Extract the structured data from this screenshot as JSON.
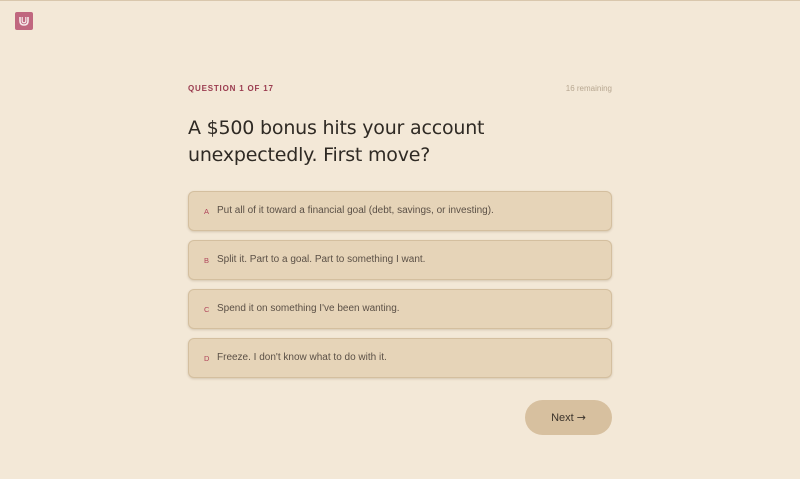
{
  "brand": {
    "logo_icon": "u-shaped-logo-icon",
    "logo_color": "#c0677f"
  },
  "question": {
    "counter": "QUESTION 1 OF 17",
    "remaining": "16 remaining",
    "title": "A $500 bonus hits your account unexpectedly. First move?"
  },
  "options": [
    {
      "letter": "A",
      "text": "Put all of it toward a financial goal (debt, savings, or investing)."
    },
    {
      "letter": "B",
      "text": "Split it. Part to a goal. Part to something I want."
    },
    {
      "letter": "C",
      "text": "Spend it on something I've been wanting."
    },
    {
      "letter": "D",
      "text": "Freeze. I don't know what to do with it."
    }
  ],
  "next_button": {
    "label": "Next",
    "arrow": "→",
    "arrow_icon": "arrow-right-icon"
  },
  "colors": {
    "background": "#f3e8d7",
    "option_background": "#e6d4b8",
    "accent": "#9a3b4f",
    "button_background": "#d7c09f"
  }
}
